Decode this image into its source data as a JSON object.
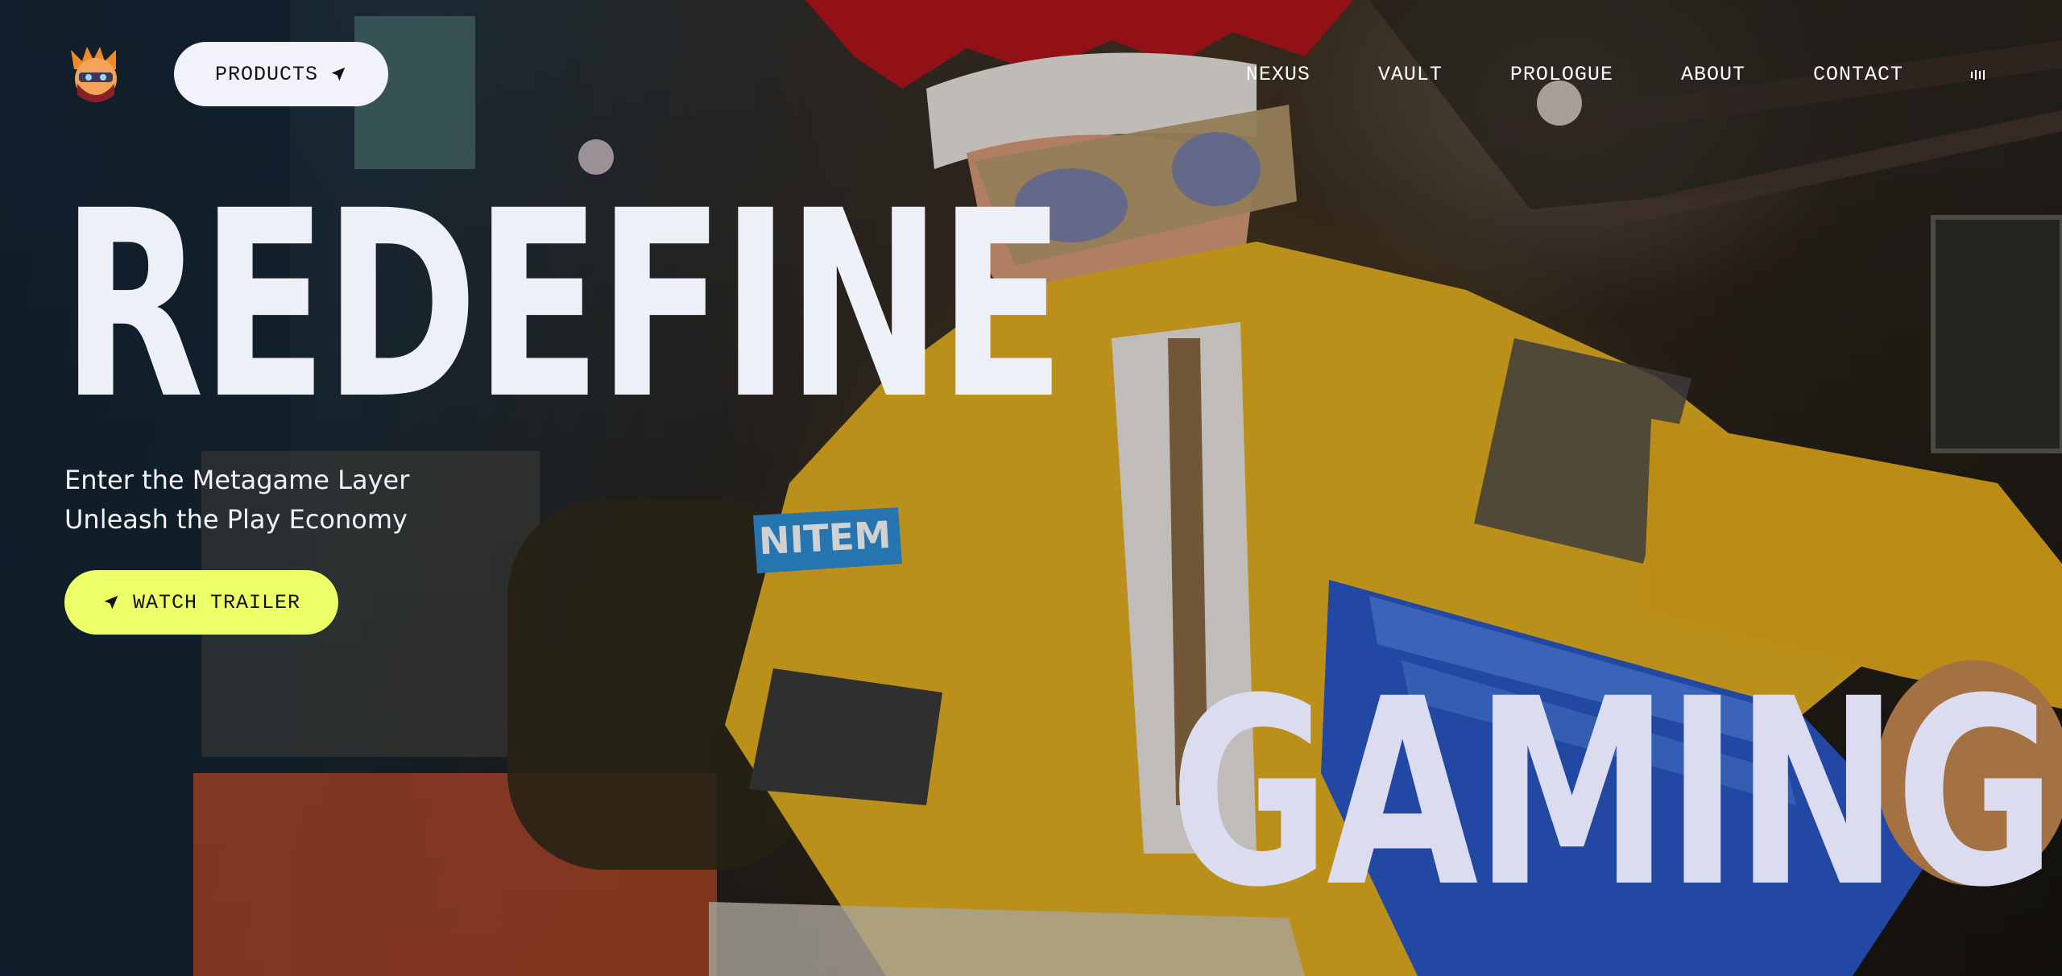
{
  "nav": {
    "products_label": "PRODUCTS",
    "links": [
      {
        "label": "NEXUS"
      },
      {
        "label": "VAULT"
      },
      {
        "label": "PROLOGUE"
      },
      {
        "label": "ABOUT"
      },
      {
        "label": "CONTACT"
      }
    ]
  },
  "hero": {
    "headline_top": "REDEFINE",
    "headline_bottom": "GAMING",
    "subtitle_line1": "Enter the Metagame Layer",
    "subtitle_line2": "Unleash the Play Economy",
    "cta_label": "WATCH TRAILER"
  },
  "colors": {
    "cta_background": "#edff66",
    "products_background": "#f2f2fa",
    "headline_top": "#eef0f8",
    "headline_bottom": "#dcdcf0",
    "nav_text": "#ffffff"
  },
  "icons": {
    "logo": "ninja-avatar-logo",
    "products": "arrow-icon",
    "cta": "arrow-icon",
    "audio": "audio-bars-icon"
  }
}
